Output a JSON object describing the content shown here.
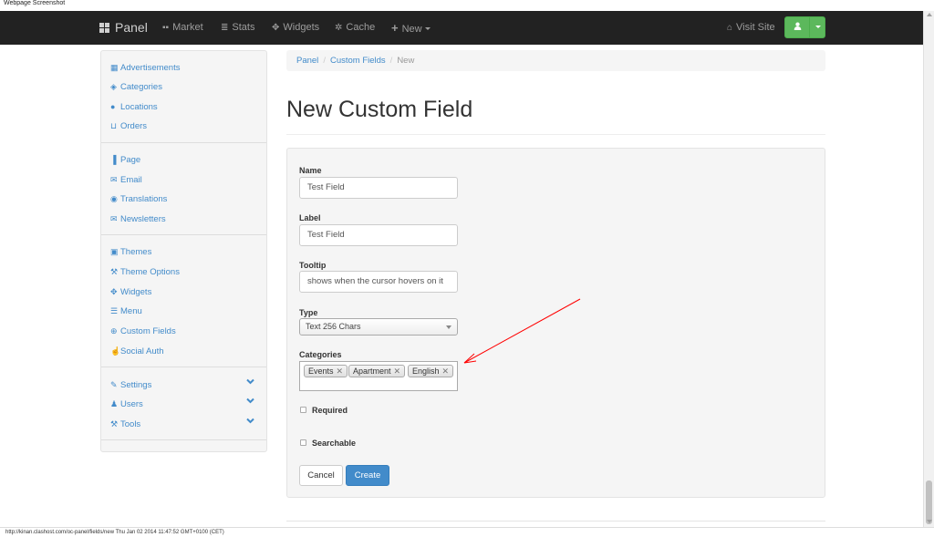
{
  "screenshot_label": "Webpage Screenshot",
  "navbar": {
    "brand": "Panel",
    "items": [
      {
        "label": "Market",
        "icon": "th-large-icon"
      },
      {
        "label": "Stats",
        "icon": "align-left-icon"
      },
      {
        "label": "Widgets",
        "icon": "move-icon"
      },
      {
        "label": "Cache",
        "icon": "cog-icon"
      },
      {
        "label": "New",
        "icon": "plus-icon"
      }
    ],
    "visit_site": "Visit Site",
    "user_button_color": "#5cb85c"
  },
  "sidebar": {
    "groups": [
      [
        {
          "label": "Advertisements",
          "icon": "th-large-icon"
        },
        {
          "label": "Categories",
          "icon": "tags-icon"
        },
        {
          "label": "Locations",
          "icon": "map-marker-icon"
        },
        {
          "label": "Orders",
          "icon": "shopping-cart-icon"
        }
      ],
      [
        {
          "label": "Page",
          "icon": "file-icon"
        },
        {
          "label": "Email",
          "icon": "envelope-icon"
        },
        {
          "label": "Translations",
          "icon": "globe-icon"
        },
        {
          "label": "Newsletters",
          "icon": "envelope-icon"
        }
      ],
      [
        {
          "label": "Themes",
          "icon": "picture-icon"
        },
        {
          "label": "Theme Options",
          "icon": "wrench-icon"
        },
        {
          "label": "Widgets",
          "icon": "move-icon"
        },
        {
          "label": "Menu",
          "icon": "list-icon"
        },
        {
          "label": "Custom Fields",
          "icon": "plus-sign-icon"
        },
        {
          "label": "Social Auth",
          "icon": "thumbs-up-icon"
        }
      ],
      [
        {
          "label": "Settings",
          "icon": "edit-icon"
        },
        {
          "label": "Users",
          "icon": "user-icon"
        },
        {
          "label": "Tools",
          "icon": "wrench-icon"
        }
      ]
    ]
  },
  "breadcrumb": {
    "items": [
      "Panel",
      "Custom Fields"
    ],
    "active": "New"
  },
  "page_title": "New Custom Field",
  "form": {
    "name_label": "Name",
    "name_value": "Test Field",
    "label_label": "Label",
    "label_value": "Test Field",
    "tooltip_label": "Tooltip",
    "tooltip_value": "shows when the cursor hovers on it",
    "type_label": "Type",
    "type_value": "Text 256 Chars",
    "categories_label": "Categories",
    "categories": [
      "Events",
      "Apartment",
      "English"
    ],
    "required_label": "Required",
    "searchable_label": "Searchable",
    "cancel_label": "Cancel",
    "create_label": "Create"
  },
  "annotation_color": "#ff0000",
  "status_bar": "http://kinan.clashost.com/oc-panel/fields/new Thu Jan 02 2014 11:47:52 GMT+0100 (CET)"
}
